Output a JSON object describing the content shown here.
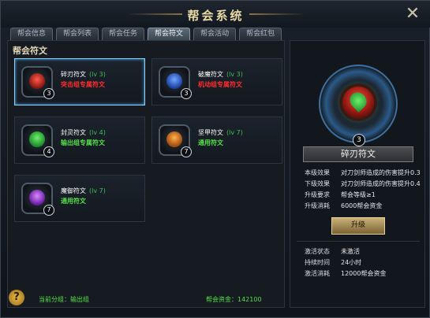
{
  "window": {
    "title": "帮会系统",
    "close_icon": "close-icon"
  },
  "tabs": [
    {
      "label": "帮会信息",
      "active": false
    },
    {
      "label": "帮会列表",
      "active": false
    },
    {
      "label": "帮会任务",
      "active": false
    },
    {
      "label": "帮会符文",
      "active": true
    },
    {
      "label": "帮会活动",
      "active": false
    },
    {
      "label": "帮会红包",
      "active": false
    }
  ],
  "left_panel": {
    "title": "帮会符文",
    "runes": [
      {
        "name": "碎刃符文",
        "level": "(lv 3)",
        "badge": "3",
        "desc": "突击组专属符文",
        "desc_color": "red",
        "selected": true,
        "gem_color": "#e0261c"
      },
      {
        "name": "破魔符文",
        "level": "(lv 3)",
        "badge": "3",
        "desc": "机动组专属符文",
        "desc_color": "red",
        "selected": false,
        "gem_color": "#2f6fe8"
      },
      {
        "name": "封灵符文",
        "level": "(lv 4)",
        "badge": "4",
        "desc": "输出组专属符文",
        "desc_color": "green",
        "selected": false,
        "gem_color": "#23c23a"
      },
      {
        "name": "坚甲符文",
        "level": "(lv 7)",
        "badge": "7",
        "desc": "通用符文",
        "desc_color": "green",
        "selected": false,
        "gem_color": "#e0791c"
      },
      {
        "name": "魔御符文",
        "level": "(lv 7)",
        "badge": "7",
        "desc": "通用符文",
        "desc_color": "green",
        "selected": false,
        "gem_color": "#a53ae0"
      }
    ]
  },
  "footer": {
    "group": "当前分组：输出组",
    "funds": "帮会资金：142100"
  },
  "detail": {
    "badge": "3",
    "name": "碎刃符文",
    "current_label": "本级效果",
    "current_value": "对刀剑师造成的伤害提升0.3",
    "next_label": "下级效果",
    "next_value": "对刀剑师造成的伤害提升0.4",
    "require_label": "升级要求",
    "require_value": "帮会等级≥1",
    "cost_label": "升级消耗",
    "cost_value": "6000帮会资金",
    "upgrade_button": "升级",
    "status_label": "激活状态",
    "status_value": "未激活",
    "duration_label": "持续时间",
    "duration_value": "24小时",
    "activate_cost_label": "激活消耗",
    "activate_cost_value": "12000帮会资金"
  },
  "colors": {
    "accent_blue": "#8fd1ff",
    "red": "#ff2d2d",
    "green": "#55e04a",
    "gold": "#c9b178"
  }
}
